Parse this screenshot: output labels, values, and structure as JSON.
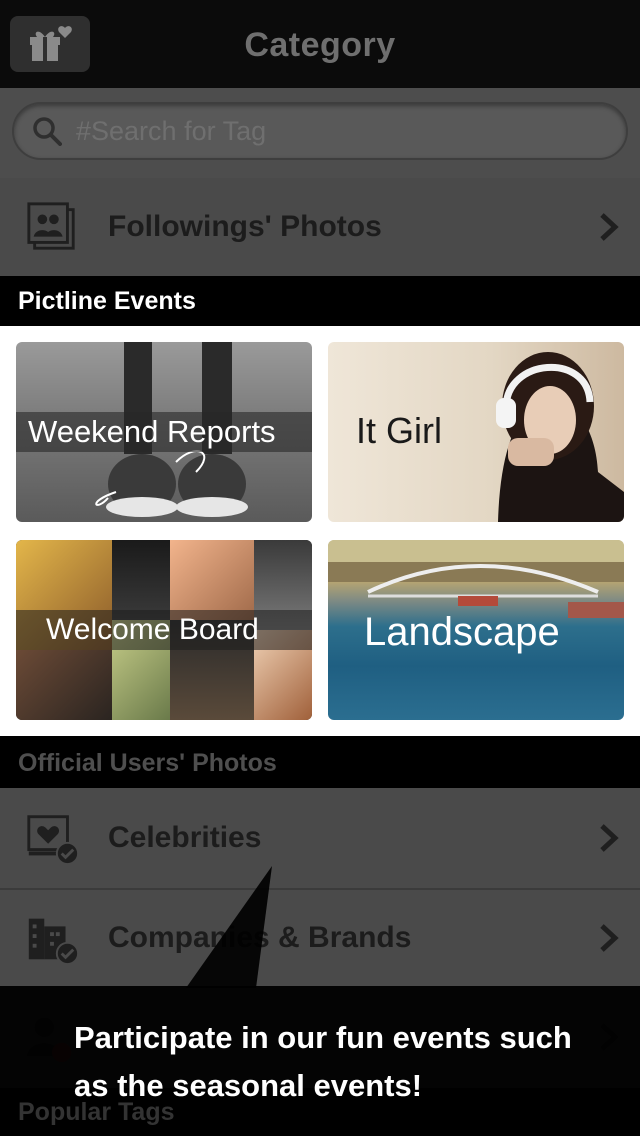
{
  "header": {
    "title": "Category",
    "gift_icon": "gift-icon"
  },
  "search": {
    "placeholder": "#Search for Tag"
  },
  "followings": {
    "label": "Followings' Photos",
    "icon": "photos-icon"
  },
  "events": {
    "heading": "Pictline Events",
    "tiles": [
      {
        "label": "Weekend Reports"
      },
      {
        "label": "It Girl"
      },
      {
        "label": "Welcome Board"
      },
      {
        "label": "Landscape"
      }
    ]
  },
  "official": {
    "heading": "Official Users' Photos",
    "rows": [
      {
        "label": "Celebrities",
        "icon": "celebrity-icon"
      },
      {
        "label": "Companies & Brands",
        "icon": "building-icon"
      },
      {
        "label": "",
        "icon": "people-icon"
      }
    ]
  },
  "popular": {
    "heading": "Popular Tags"
  },
  "tooltip": {
    "text": "Participate in our fun events such as the seasonal events!"
  },
  "colors": {
    "background": "#4a4a4a",
    "header": "#0b0b0b",
    "section": "#000000",
    "tooltip": "#000000"
  }
}
